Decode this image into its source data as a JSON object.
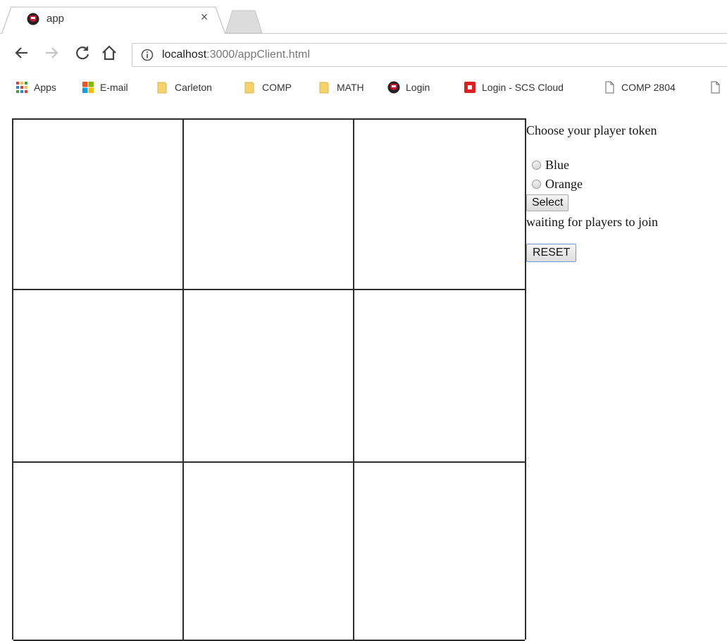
{
  "browser": {
    "tab_title": "app",
    "tab_close": "×",
    "url_host": "localhost",
    "url_rest": ":3000/appClient.html"
  },
  "bookmarks": [
    {
      "label": "Apps",
      "icon": "apps-grid-icon"
    },
    {
      "label": "E-mail",
      "icon": "windows-logo-icon"
    },
    {
      "label": "Carleton",
      "icon": "folder-icon"
    },
    {
      "label": "COMP",
      "icon": "folder-icon"
    },
    {
      "label": "MATH",
      "icon": "folder-icon"
    },
    {
      "label": "Login",
      "icon": "shield-crest-icon"
    },
    {
      "label": "Login - SCS Cloud",
      "icon": "red-app-icon"
    },
    {
      "label": "COMP 2804",
      "icon": "page-icon"
    }
  ],
  "board": {
    "cells": [
      "",
      "",
      "",
      "",
      "",
      "",
      "",
      "",
      ""
    ]
  },
  "panel": {
    "prompt": "Choose your player token",
    "options": [
      "Blue",
      "Orange"
    ],
    "select_label": "Select",
    "status": "waiting for players to join",
    "reset_label": "RESET"
  },
  "colors": {
    "chrome_bg": "#ffffff",
    "grid_line": "#2d2d2d",
    "reset_border": "#6b9bd8"
  }
}
